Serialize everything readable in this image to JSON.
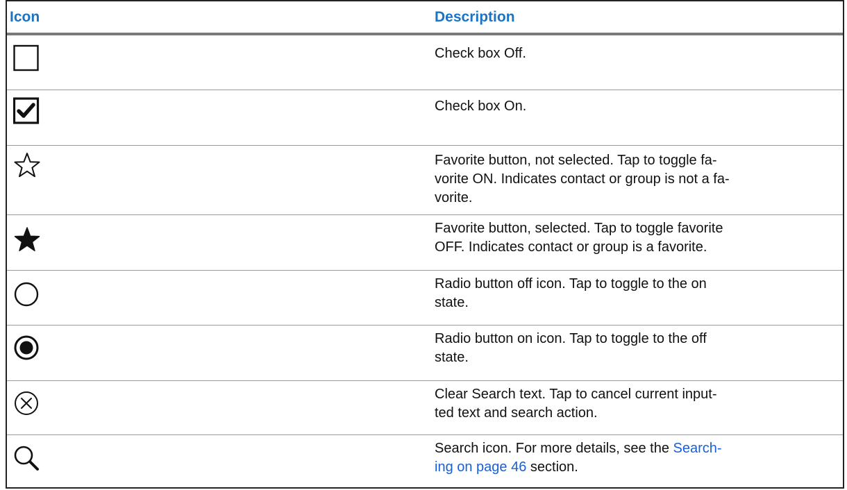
{
  "header": {
    "icon_label": "Icon",
    "description_label": "Description"
  },
  "rows": [
    {
      "icon": "checkbox-off-icon",
      "text": "Check box Off."
    },
    {
      "icon": "checkbox-on-icon",
      "text": "Check box On."
    },
    {
      "icon": "star-outline-icon",
      "text": "Favorite button, not selected. Tap to toggle fa-\nvorite ON. Indicates contact or group is not a fa-\nvorite."
    },
    {
      "icon": "star-filled-icon",
      "text": "Favorite button, selected. Tap to toggle favorite\nOFF. Indicates contact or group is a favorite."
    },
    {
      "icon": "radio-off-icon",
      "text": "Radio button off icon. Tap to toggle to the on\nstate."
    },
    {
      "icon": "radio-on-icon",
      "text": "Radio button on icon. Tap to toggle to the off\nstate."
    },
    {
      "icon": "clear-search-icon",
      "text": "Clear Search text. Tap to cancel current input-\nted text and search action."
    },
    {
      "icon": "search-icon",
      "text_before": "Search icon. For more details, see the ",
      "link_text": "Search-\ning on page 46",
      "text_after": " section."
    }
  ],
  "colors": {
    "header_text": "#1a73c4",
    "link": "#1a5fd6",
    "header_rule": "#7a7a7a"
  }
}
